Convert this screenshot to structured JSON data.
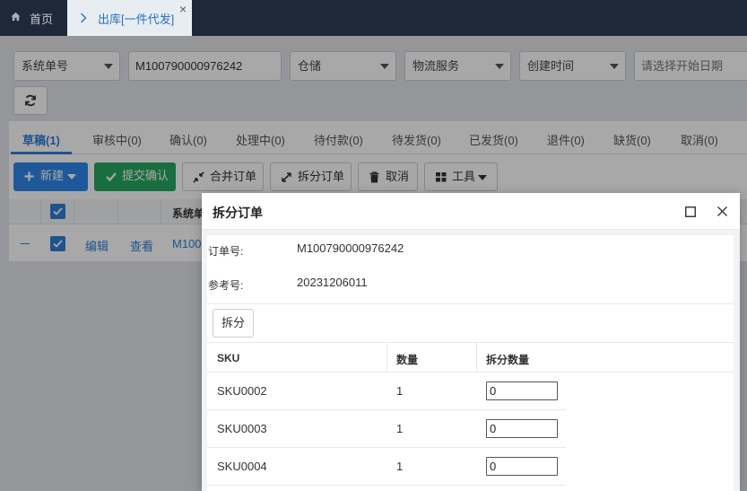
{
  "colors": {
    "topbar": "#1f2838",
    "primary": "#2f86ea",
    "success": "#27a862",
    "link": "#2f7ed8",
    "active_tab_bg": "#e8edf2"
  },
  "topbar": {
    "tabs": [
      {
        "label": "首页",
        "icon": "home-icon"
      },
      {
        "label": "出库[一件代发]",
        "icon": "chevron-right-icon",
        "active": true,
        "close_icon": "close-icon"
      }
    ]
  },
  "filters": {
    "field_select": "系统单号",
    "order_no_value": "M100790000976242",
    "warehouse_select": "仓储",
    "logistics_select": "物流服务",
    "time_select": "创建时间",
    "start_date_placeholder": "请选择开始日期",
    "refresh_icon": "refresh-icon"
  },
  "status_tabs": [
    "草稿(1)",
    "审核中(0)",
    "确认(0)",
    "处理中(0)",
    "待付款(0)",
    "待发货(0)",
    "已发货(0)",
    "退件(0)",
    "缺货(0)",
    "取消(0)"
  ],
  "active_status_tab": "草稿(1)",
  "toolbar": {
    "new": "新建",
    "submit": "提交确认",
    "merge": "合并订单",
    "split": "拆分订单",
    "cancel": "取消",
    "tools": "工具"
  },
  "orders_table": {
    "header_checked": true,
    "columns": {
      "system_no": "系统单"
    },
    "rows": [
      {
        "checked": true,
        "edit": "编辑",
        "view": "查看",
        "system_no": "M100"
      }
    ]
  },
  "modal": {
    "title": "拆分订单",
    "order_no_label": "订单号:",
    "order_no": "M100790000976242",
    "ref_label": "参考号:",
    "ref_no": "20231206011",
    "split_button": "拆分",
    "columns": [
      "SKU",
      "数量",
      "拆分数量"
    ],
    "rows": [
      {
        "sku": "SKU0002",
        "qty": "1",
        "split_qty": "0"
      },
      {
        "sku": "SKU0003",
        "qty": "1",
        "split_qty": "0"
      },
      {
        "sku": "SKU0004",
        "qty": "1",
        "split_qty": "0"
      }
    ]
  }
}
